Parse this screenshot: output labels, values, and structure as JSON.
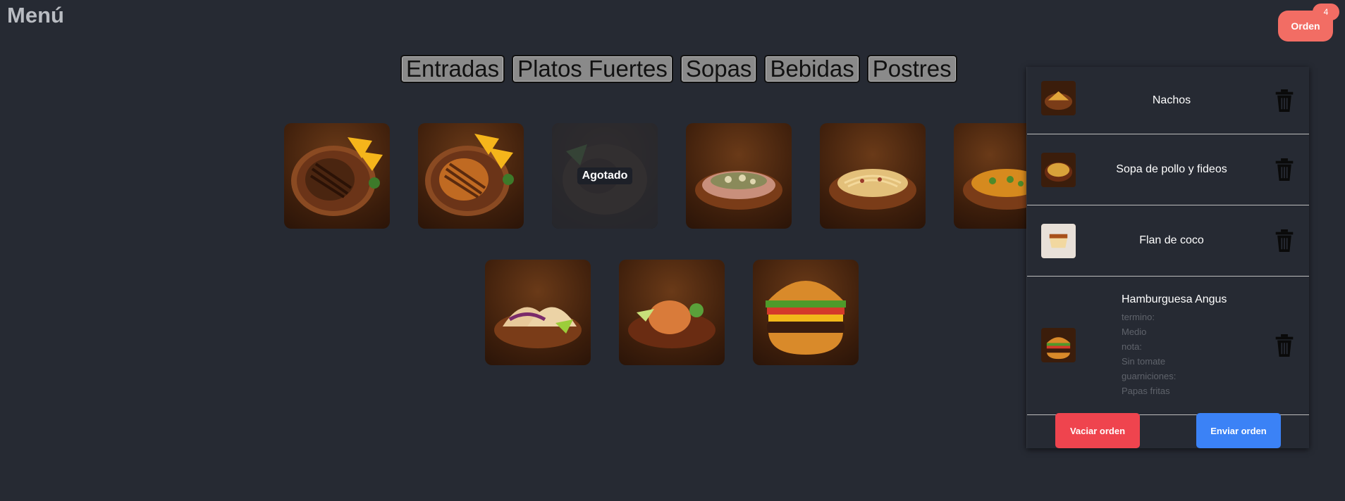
{
  "header": {
    "title": "Menú",
    "order_button": "Orden",
    "order_count": "4"
  },
  "categories": [
    "Entradas",
    "Platos Fuertes",
    "Sopas",
    "Bebidas",
    "Postres"
  ],
  "menu": {
    "items": [
      {
        "name": "chicken-plate-1",
        "sold_out": false
      },
      {
        "name": "chicken-plate-2",
        "sold_out": false
      },
      {
        "name": "sold-out-plate",
        "sold_out": true,
        "label": "Agotado"
      },
      {
        "name": "steak-mushroom-plate",
        "sold_out": false
      },
      {
        "name": "spaghetti-plate",
        "sold_out": false
      },
      {
        "name": "curry-plate",
        "sold_out": false
      },
      {
        "name": "tacos-plate",
        "sold_out": false
      },
      {
        "name": "rice-plate",
        "sold_out": false
      },
      {
        "name": "burger-plate",
        "sold_out": false
      }
    ]
  },
  "order": {
    "items": [
      {
        "name": "Nachos"
      },
      {
        "name": "Sopa de pollo y fideos"
      },
      {
        "name": "Flan de coco"
      },
      {
        "name": "Hamburguesa Angus",
        "details": [
          "termino:",
          "Medio",
          "nota:",
          "Sin tomate",
          "guarniciones:",
          "Papas fritas"
        ]
      }
    ],
    "clear_label": "Vaciar orden",
    "send_label": "Enviar orden"
  },
  "colors": {
    "background": "#262a33",
    "accent": "#f26d64",
    "danger": "#ef444e",
    "primary": "#3b82f6"
  }
}
